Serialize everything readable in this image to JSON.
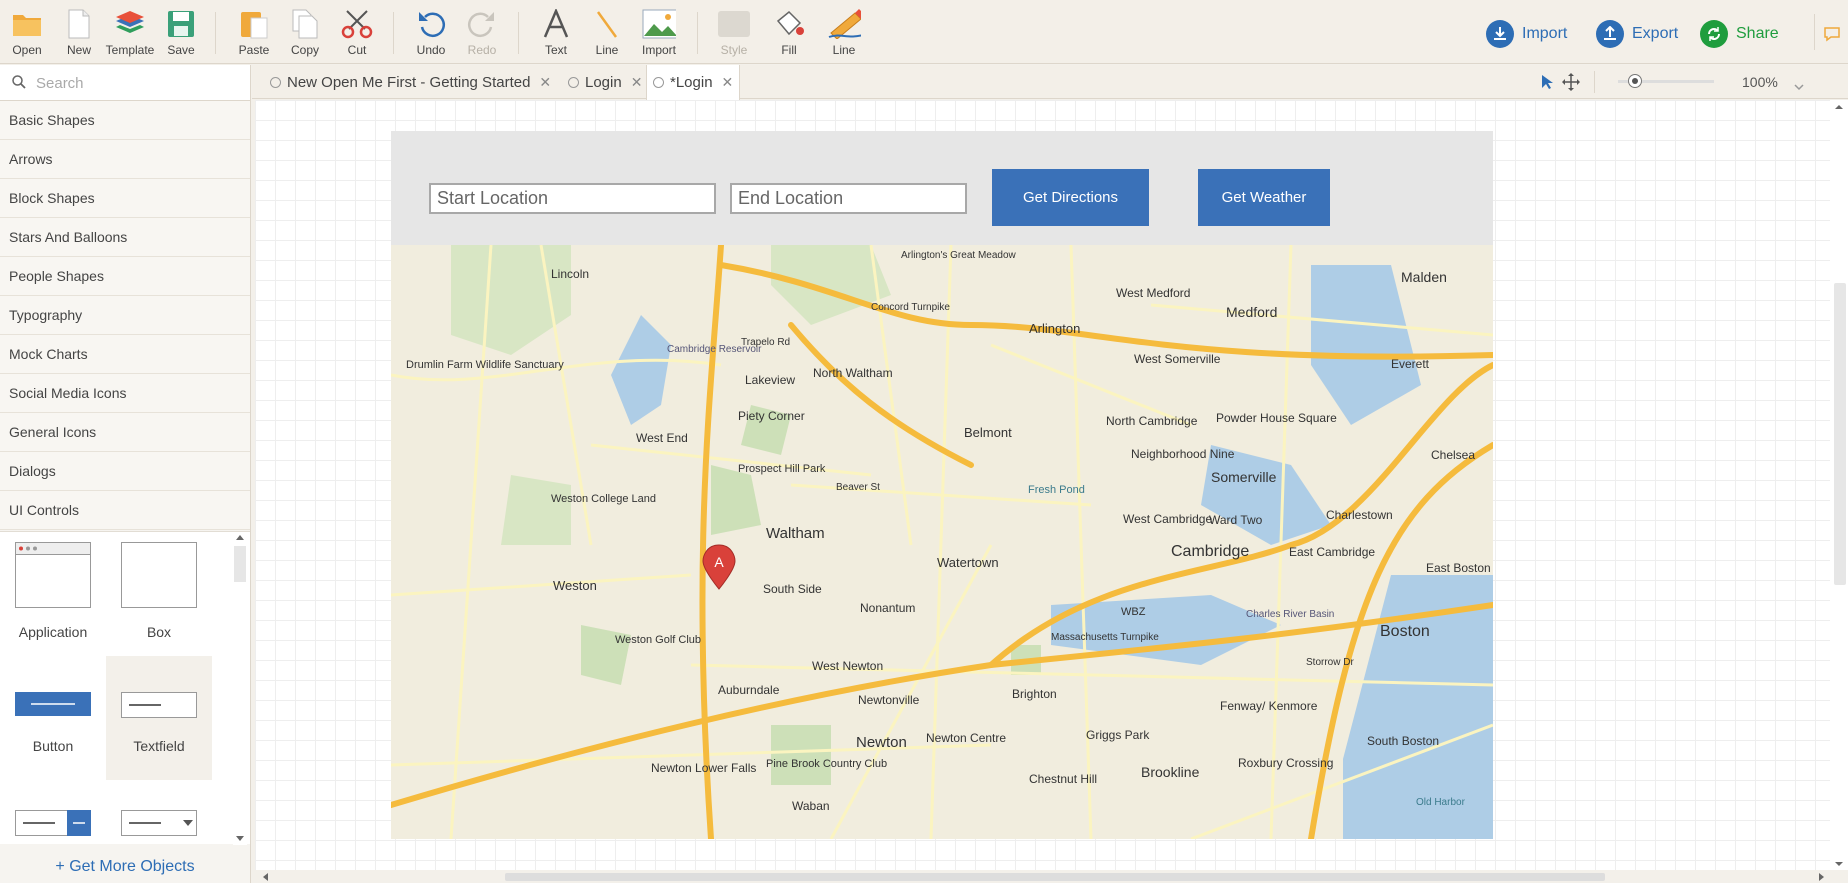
{
  "toolbar": {
    "items": [
      {
        "label": "Open",
        "icon": "folder-icon"
      },
      {
        "label": "New",
        "icon": "new-page-icon"
      },
      {
        "label": "Template",
        "icon": "template-icon"
      },
      {
        "label": "Save",
        "icon": "save-icon"
      },
      {
        "label": "Paste",
        "icon": "paste-icon"
      },
      {
        "label": "Copy",
        "icon": "copy-icon"
      },
      {
        "label": "Cut",
        "icon": "scissors-icon"
      },
      {
        "label": "Undo",
        "icon": "undo-icon"
      },
      {
        "label": "Redo",
        "icon": "redo-icon"
      },
      {
        "label": "Text",
        "icon": "text-icon"
      },
      {
        "label": "Line",
        "icon": "line-icon"
      },
      {
        "label": "Import",
        "icon": "image-import-icon"
      },
      {
        "label": "Style",
        "icon": "style-icon"
      },
      {
        "label": "Fill",
        "icon": "fill-bucket-icon"
      },
      {
        "label": "Line",
        "icon": "pencil-icon"
      }
    ],
    "import_label": "Import",
    "export_label": "Export",
    "share_label": "Share"
  },
  "sidebar": {
    "search_placeholder": "Search",
    "categories": [
      "Basic Shapes",
      "Arrows",
      "Block Shapes",
      "Stars And Balloons",
      "People Shapes",
      "Typography",
      "Mock Charts",
      "Social Media Icons",
      "General Icons",
      "Dialogs",
      "UI Controls"
    ],
    "shapes": [
      "Application",
      "Box",
      "Button",
      "Textfield"
    ],
    "more_label": "+ Get More Objects"
  },
  "tabs": [
    {
      "label": "New Open Me First - Getting Started"
    },
    {
      "label": "Login"
    },
    {
      "label": "*Login"
    }
  ],
  "zoom": {
    "label": "100%",
    "level_percent": 100
  },
  "mockup": {
    "start_placeholder": "Start Location",
    "end_placeholder": "End Location",
    "directions_button": "Get Directions",
    "weather_button": "Get Weather",
    "map_labels": [
      "Lincoln",
      "Arlington's Great Meadow",
      "West Medford",
      "Medford",
      "Malden",
      "Arlington",
      "West Somerville",
      "Everett",
      "Drumlin Farm Wildlife Sanctuary",
      "Cambridge Reservoir",
      "Lakeview",
      "North Waltham",
      "Piety Corner",
      "Belmont",
      "North Cambridge",
      "Powder House Square",
      "Neighborhood Nine",
      "Somerville",
      "Chelsea",
      "West End",
      "Prospect Hill Park",
      "Fresh Pond",
      "Weston College Land",
      "West Cambridge",
      "Ward Two",
      "Charlestown",
      "Waltham",
      "Watertown",
      "Cambridge",
      "East Cambridge",
      "East Boston",
      "Weston",
      "South Side",
      "Nonantum",
      "WBZ",
      "Charles River Basin",
      "Boston",
      "Weston Golf Club",
      "West Newton",
      "Auburndale",
      "Newtonville",
      "Brighton",
      "Fenway/ Kenmore",
      "South Boston",
      "Newton",
      "Newton Centre",
      "Griggs Park",
      "Brookline",
      "Roxbury Crossing",
      "Newton Lower Falls",
      "Pine Brook Country Club",
      "Chestnut Hill",
      "Waban",
      "Old Harbor",
      "Concord Turnpike",
      "Massachusetts Turnpike",
      "Trapelo Rd",
      "Beaver St",
      "Storrow Dr",
      "A"
    ]
  }
}
